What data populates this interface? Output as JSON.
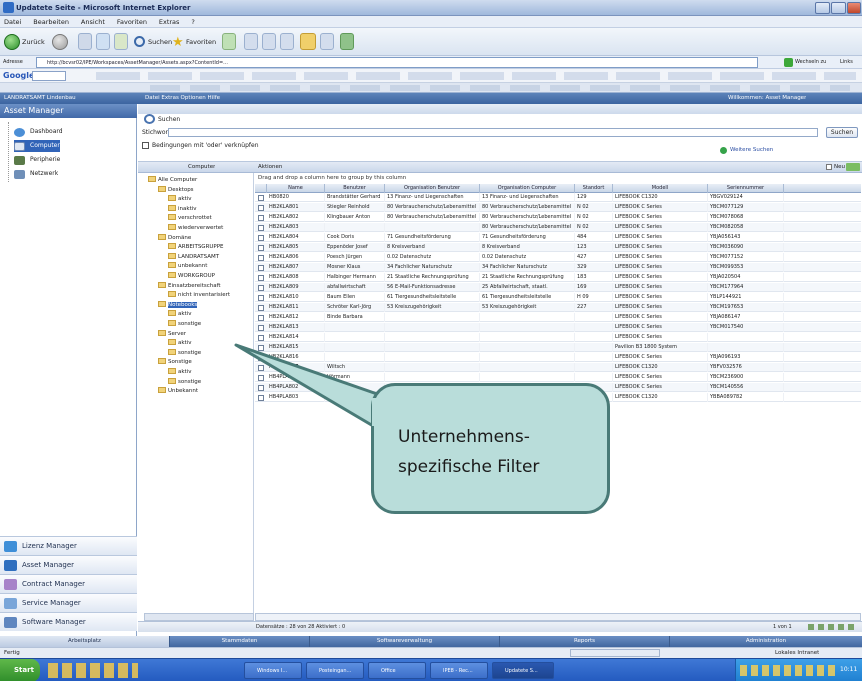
{
  "browser": {
    "title": "Updatete Seite - Microsoft Internet Explorer",
    "menu": [
      "Datei",
      "Bearbeiten",
      "Ansicht",
      "Favoriten",
      "Extras",
      "?"
    ],
    "toolbar": {
      "back": "Zurück",
      "search": "Suchen",
      "favorites": "Favoriten"
    },
    "address_label": "Adresse",
    "address": "http://bcvsr02/IPE/Workspaces/AssetManager/Assets.aspx?ContentId=...",
    "go_label": "Wechseln zu",
    "links_label": "Links",
    "google_label": "Google"
  },
  "app": {
    "header_left": "LANDRATSAMT Lindenbau",
    "header_menu": "Datei  Extras  Optionen  Hilfe",
    "header_right": "Willkommen: Asset Manager",
    "sidebar_title": "Asset Manager",
    "sidebar_items": [
      "Dashboard",
      "Computer",
      "Peripherie",
      "Netzwerk"
    ],
    "modules": [
      "Lizenz Manager",
      "Asset Manager",
      "Contract Manager",
      "Service Manager",
      "Software Manager"
    ]
  },
  "search": {
    "label": "Suchen",
    "keyword_label": "Stichwort:",
    "checkbox_label": "Bedingungen mit 'oder' verknüpfen",
    "button": "Suchen",
    "more_label": "Weitere Suchen"
  },
  "filter": {
    "left_header": "Computer",
    "right_header": "Aktionen",
    "new_label": "Neu",
    "group_hint": "Drag and drop a column here to group by this column"
  },
  "tree": [
    {
      "label": "Alle Computer",
      "level": 0
    },
    {
      "label": "Desktops",
      "level": 1
    },
    {
      "label": "aktiv",
      "level": 2
    },
    {
      "label": "inaktiv",
      "level": 2
    },
    {
      "label": "verschrottet",
      "level": 2
    },
    {
      "label": "wiederverwertet",
      "level": 2
    },
    {
      "label": "Domäne",
      "level": 1
    },
    {
      "label": "ARBEITSGRUPPE",
      "level": 2
    },
    {
      "label": "LANDRATSAMT",
      "level": 2
    },
    {
      "label": "unbekannt",
      "level": 2
    },
    {
      "label": "WORKGROUP",
      "level": 2
    },
    {
      "label": "Einsatzbereitschaft",
      "level": 1
    },
    {
      "label": "nicht inventarisiert",
      "level": 2
    },
    {
      "label": "Notebooks",
      "level": 1
    },
    {
      "label": "aktiv",
      "level": 2
    },
    {
      "label": "sonstige",
      "level": 2
    },
    {
      "label": "Server",
      "level": 1
    },
    {
      "label": "aktiv",
      "level": 2
    },
    {
      "label": "sonstige",
      "level": 2
    },
    {
      "label": "Sonstige",
      "level": 1
    },
    {
      "label": "aktiv",
      "level": 2
    },
    {
      "label": "sonstige",
      "level": 2
    },
    {
      "label": "Unbekannt",
      "level": 1
    }
  ],
  "grid": {
    "columns": [
      "Name",
      "Benutzer",
      "Organisation Benutzer",
      "Organisation Computer",
      "Standort",
      "Modell",
      "Seriennummer"
    ],
    "rows": [
      [
        "HB0820",
        "Brandstätter Gerhard",
        "13 Finanz- und Liegenschaften",
        "13 Finanz- und Liegenschaften",
        "129",
        "LIFEBOOK C1320",
        "YBGV029124"
      ],
      [
        "HB2KLA801",
        "Stiegler Reinhold",
        "80 Verbraucherschutz/Lebensmittel",
        "80 Verbraucherschutz/Lebensmittel",
        "N 02",
        "LIFEBOOK C Series",
        "YBCM077129"
      ],
      [
        "HB2KLA802",
        "Klingbauer Anton",
        "80 Verbraucherschutz/Lebensmittel",
        "80 Verbraucherschutz/Lebensmittel",
        "N 02",
        "LIFEBOOK C Series",
        "YBCM078068"
      ],
      [
        "HB2KLA803",
        "",
        "",
        "80 Verbraucherschutz/Lebensmittel",
        "N 02",
        "LIFEBOOK C Series",
        "YBCM082058"
      ],
      [
        "HB2KLA804",
        "Cook Doris",
        "71 Gesundheitsförderung",
        "71 Gesundheitsförderung",
        "484",
        "LIFEBOOK C Series",
        "YBJA056143"
      ],
      [
        "HB2KLA805",
        "Eppenöder Josef",
        "8 Kreisverband",
        "8 Kreisverband",
        "123",
        "LIFEBOOK C Series",
        "YBCM036090"
      ],
      [
        "HB2KLA806",
        "Poesch Jürgen",
        "0.02 Datenschutz",
        "0.02 Datenschutz",
        "427",
        "LIFEBOOK C Series",
        "YBCM077152"
      ],
      [
        "HB2KLA807",
        "Mosner Klaus",
        "34 Fachlicher Naturschutz",
        "34 Fachlicher Naturschutz",
        "329",
        "LIFEBOOK C Series",
        "YBCM099353"
      ],
      [
        "HB2KLA808",
        "Halbinger Hermann",
        "21 Staatliche Rechnungsprüfung",
        "21 Staatliche Rechnungsprüfung",
        "183",
        "LIFEBOOK C Series",
        "YBJA020504"
      ],
      [
        "HB2KLA809",
        "abfallwirtschaft",
        "56 E-Mail-Funktionsadresse",
        "25 Abfallwirtschaft, staatl.",
        "169",
        "LIFEBOOK C Series",
        "YBCM177964"
      ],
      [
        "HB2KLA810",
        "Baum Ellen",
        "61 Tiergesundheitsleitstelle",
        "61 Tiergesundheitsleitstelle",
        "H 09",
        "LIFEBOOK C Series",
        "YBLP144921"
      ],
      [
        "HB2KLA811",
        "Schröter Karl-Jörg",
        "53 Kreiszugehörigkeit",
        "53 Kreiszugehörigkeit",
        "227",
        "LIFEBOOK C Series",
        "YBCM197653"
      ],
      [
        "HB2KLA812",
        "Binde Barbara",
        "",
        "",
        "",
        "LIFEBOOK C Series",
        "YBJA086147"
      ],
      [
        "HB2KLA813",
        "",
        "",
        "",
        "",
        "LIFEBOOK C Series",
        "YBCM017540"
      ],
      [
        "HB2KLA814",
        "",
        "",
        "",
        "",
        "LIFEBOOK C Series",
        ""
      ],
      [
        "HB2KLA815",
        "",
        "",
        "",
        "",
        "Pavilion B3 1800 System",
        ""
      ],
      [
        "HB2KLA816",
        "",
        "",
        "",
        "",
        "LIFEBOOK C Series",
        "YBJA096193"
      ],
      [
        "HB2KLA817",
        "Wiltsch",
        "",
        "",
        "",
        "LIFEBOOK C1320",
        "YBFV032576"
      ],
      [
        "HB4PLA801",
        "Hörmann",
        "",
        "",
        "",
        "LIFEBOOK C Series",
        "YBCM236900"
      ],
      [
        "HB4PLA802",
        "Wieder",
        "",
        "",
        "",
        "LIFEBOOK C Series",
        "YBCM140556"
      ],
      [
        "HB4PLA803",
        "Leinhos",
        "",
        "",
        "",
        "LIFEBOOK C1320",
        "YBBA089782"
      ]
    ],
    "footer": "Datensätze : 28 von 28   Aktiviert : 0",
    "pager": "1 von 1"
  },
  "bottom_tabs": [
    "Arbeitsplatz",
    "Stammdaten",
    "Softwareverwaltung",
    "Reports",
    "Administration"
  ],
  "statusbar": {
    "left": "Fertig",
    "right": "Lokales Intranet"
  },
  "taskbar": {
    "start": "Start",
    "tasks": [
      "Windows I...",
      "Posteingan...",
      "Office",
      "IPE8 - Rec...",
      "Updatete S..."
    ],
    "time": "10:11"
  },
  "callout": {
    "line1": "Unternehmens-",
    "line2": "spezifische Filter"
  },
  "colors": {
    "accent": "#4169a8",
    "callout_fill": "#b9ddda",
    "callout_border": "#497a77"
  }
}
